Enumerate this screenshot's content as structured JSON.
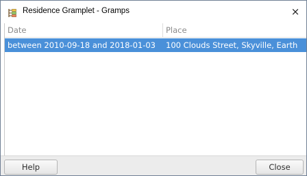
{
  "window": {
    "title": "Residence Gramplet - Gramps",
    "app_icon": "gramps-tree-icon",
    "close_glyph": "×"
  },
  "table": {
    "columns": [
      "Date",
      "Place"
    ],
    "rows": [
      {
        "date": "between 2010-09-18 and 2018-01-03",
        "place": "100 Clouds Street, Skyville, Earth",
        "selected": true
      }
    ]
  },
  "buttons": {
    "help_label": "Help",
    "close_label": "Close"
  },
  "colors": {
    "selection": "#4a90d9",
    "header_text": "#8a8a8a",
    "button_bar": "#ececec"
  }
}
